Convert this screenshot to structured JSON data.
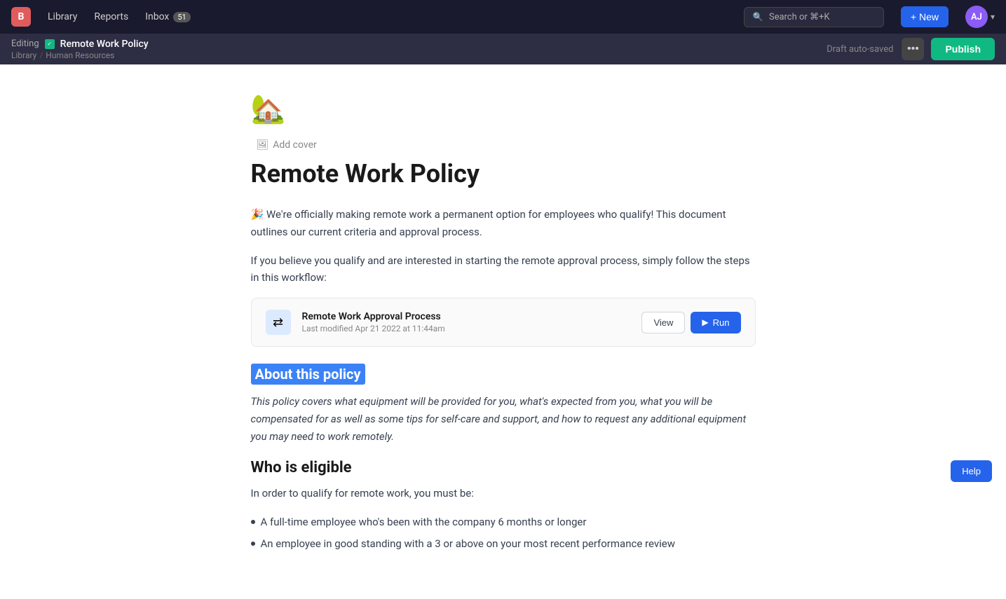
{
  "topnav": {
    "logo_label": "B",
    "library_label": "Library",
    "reports_label": "Reports",
    "inbox_label": "Inbox",
    "inbox_count": "51",
    "search_placeholder": "Search or ⌘+K",
    "new_label": "+ New",
    "avatar_initials": "AJ"
  },
  "editingbar": {
    "editing_label": "Editing",
    "doc_title": "Remote Work Policy",
    "breadcrumb_library": "Library",
    "breadcrumb_sep": "/",
    "breadcrumb_section": "Human Resources",
    "draft_status": "Draft auto-saved",
    "more_label": "•••",
    "publish_label": "Publish"
  },
  "document": {
    "emoji": "🏡",
    "add_cover_label": "Add cover",
    "title": "Remote Work Policy",
    "intro_paragraph1": "🎉 We're officially making remote work a permanent option for employees who qualify! This document outlines our current criteria and approval process.",
    "intro_paragraph2": "If you believe you qualify and are interested in starting the remote approval process, simply follow the steps in this workflow:",
    "workflow": {
      "title": "Remote Work Approval Process",
      "meta": "Last modified Apr 21 2022 at 11:44am",
      "view_label": "View",
      "run_label": "Run"
    },
    "section_about_heading": "About this policy",
    "section_about_text": "This policy covers what equipment will be provided for you, what's expected from you, what you will be compensated for as well as some tips for self-care and support, and how to request any additional equipment you may need to work remotely.",
    "section_eligible_heading": "Who is eligible",
    "section_eligible_intro": "In order to qualify for remote work, you must be:",
    "bullets": [
      "A full-time employee who's been with the company 6 months or longer",
      "An employee in good standing with a 3 or above on your most recent performance review"
    ]
  },
  "help_label": "Help"
}
